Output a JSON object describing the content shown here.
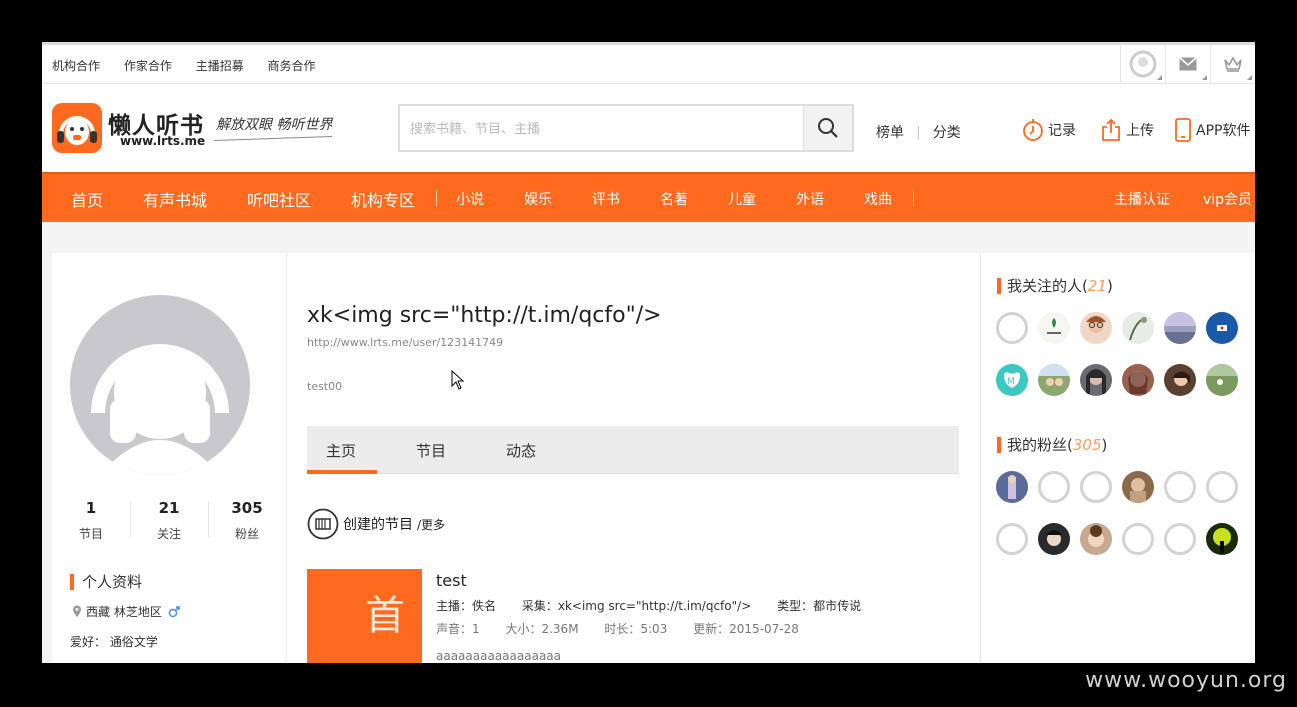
{
  "topbar": {
    "links": [
      "机构合作",
      "作家合作",
      "主播招募",
      "商务合作"
    ]
  },
  "header": {
    "logo_text": "懒人听书",
    "logo_url": "www.lrts.me",
    "slogan": "解放双眼 畅听世界",
    "search_placeholder": "搜索书籍、节目、主播",
    "links": [
      "榜单",
      "分类"
    ],
    "actions": {
      "history": "记录",
      "upload": "上传",
      "app": "APP软件"
    }
  },
  "nav": {
    "main": [
      "首页",
      "有声书城",
      "听吧社区",
      "机构专区"
    ],
    "categories": [
      "小说",
      "娱乐",
      "评书",
      "名著",
      "儿童",
      "外语",
      "戏曲"
    ],
    "right": [
      "主播认证",
      "vip会员"
    ]
  },
  "profile": {
    "stats": [
      {
        "value": "1",
        "label": "节目"
      },
      {
        "value": "21",
        "label": "关注"
      },
      {
        "value": "305",
        "label": "粉丝"
      }
    ],
    "info_title": "个人资料",
    "location": "西藏 林芝地区",
    "gender_icon": "male-icon",
    "hobby_label": "爱好：",
    "hobby_value": "通俗文学"
  },
  "main": {
    "username": "xk<img src=\"http://t.im/qcfo\"/>",
    "user_url": "http://www.lrts.me/user/123141749",
    "signature": "test00",
    "tabs": [
      "主页",
      "节目",
      "动态"
    ],
    "active_tab": 0,
    "created_title": "创建的节目",
    "created_more": "/更多",
    "program": {
      "thumb_glyph": "首",
      "title": "test",
      "host": "主播：佚名",
      "collection": "采集：xk<img src=\"http://t.im/qcfo\"/>",
      "type": "类型：都市传说",
      "episodes": "声音：1",
      "size": "大小：2.36M",
      "duration": "时长：5:03",
      "updated": "更新：2015-07-28",
      "desc": "aaaaaaaaaaaaaaaaa"
    }
  },
  "sidebar": {
    "following_title": "我关注的人",
    "following_count": "21",
    "fans_title": "我的粉丝",
    "fans_count": "305"
  },
  "watermark": "www.wooyun.org",
  "colors": {
    "accent": "#ff6a1e",
    "count": "#ff9a63"
  }
}
